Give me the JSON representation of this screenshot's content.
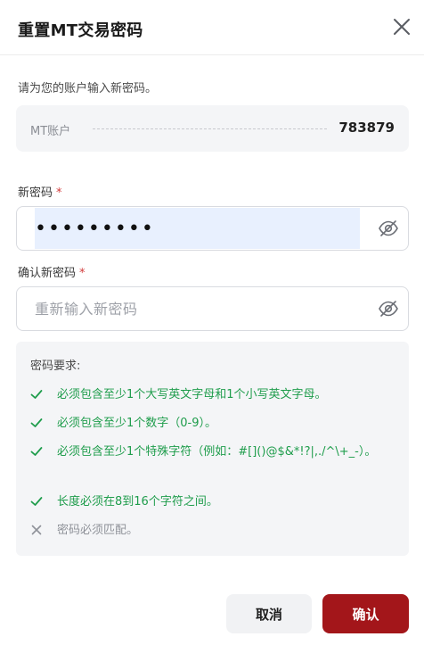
{
  "dialog": {
    "title": "重置MT交易密码",
    "intro": "请为您的账户输入新密码。"
  },
  "account": {
    "label": "MT账户",
    "value": "783879"
  },
  "new_password": {
    "label": "新密码",
    "required_mark": "*",
    "value": "•••••••••"
  },
  "confirm_password": {
    "label": "确认新密码",
    "required_mark": "*",
    "placeholder": "重新输入新密码"
  },
  "requirements": {
    "title": "密码要求:",
    "items": [
      {
        "text": "必须包含至少1个大写英文字母和1个小写英文字母。",
        "status": "ok"
      },
      {
        "text": "必须包含至少1个数字（0-9）。",
        "status": "ok"
      },
      {
        "text": "必须包含至少1个特殊字符（例如：#[]()@$&*!?|,./^\\+_-）。",
        "status": "ok"
      },
      {
        "text": "长度必须在8到16个字符之间。",
        "status": "ok"
      },
      {
        "text": "密码必须匹配。",
        "status": "fail"
      }
    ]
  },
  "buttons": {
    "cancel": "取消",
    "confirm": "确认"
  },
  "colors": {
    "ok": "#1f9d4c",
    "fail": "#8f9299",
    "primary": "#a3161a",
    "required": "#d23b3b"
  },
  "icons": {
    "close": "close-icon",
    "eye": "eye-slash-icon",
    "check": "check-icon",
    "cross": "x-icon"
  }
}
